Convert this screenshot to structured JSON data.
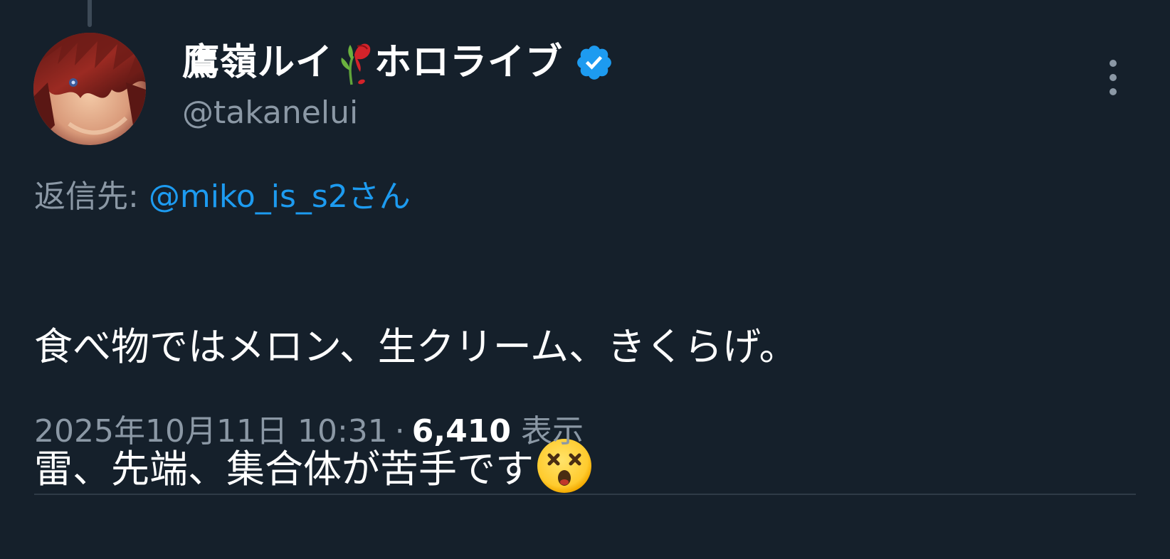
{
  "colors": {
    "background": "#15202b",
    "secondary_text": "#8b98a5",
    "link": "#1d9bf0",
    "verified_badge": "#1d9bf0"
  },
  "author": {
    "name_part1": "鷹嶺ルイ",
    "name_part2": "ホロライブ",
    "name_icon": "wilted-rose-icon",
    "verified_icon": "verified-badge-icon",
    "handle": "@takanelui"
  },
  "reply": {
    "prefix": "返信先",
    "separator": ":",
    "mention": "@miko_is_s2さん"
  },
  "tweet": {
    "line1": "食べ物ではメロン、生クリーム、きくらげ。",
    "line2": "雷、先端、集合体が苦手です",
    "emoji": "dizzy-face-icon"
  },
  "meta": {
    "date": "2025年10月11日",
    "time": "10:31",
    "dot": "·",
    "views_count": "6,410",
    "views_label": "表示"
  },
  "menu": {
    "icon": "more-vertical-icon"
  }
}
